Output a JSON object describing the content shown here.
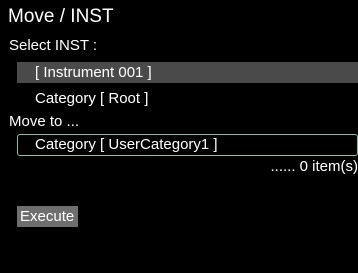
{
  "title": "Move / INST",
  "select_label": "Select INST :",
  "source": {
    "instrument": "[ Instrument 001 ]",
    "category": "Category [ Root ]"
  },
  "move_to_label": "Move to ...",
  "destination": {
    "category": "Category [ UserCategory1 ]"
  },
  "item_count": "...... 0 item(s)",
  "execute_label": "Execute",
  "colors": {
    "background": "#000000",
    "selected_row": "#4a4a4a",
    "focus_outline": "#7fc1a9",
    "button": "#6e6e6e",
    "text": "#ffffff"
  }
}
